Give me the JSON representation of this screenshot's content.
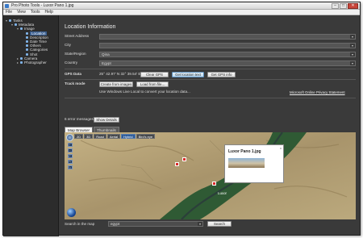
{
  "window": {
    "title": "Pro Photo Tools - Luxor Pano 1.jpg",
    "buttons": {
      "min": "–",
      "max": "□",
      "close": "✕"
    }
  },
  "menu": [
    "File",
    "View",
    "Tools",
    "Help"
  ],
  "sidebar": {
    "items": [
      {
        "label": "Tasks",
        "indent": 0,
        "twisty": "▾",
        "selected": false
      },
      {
        "label": "Metadata",
        "indent": 1,
        "twisty": "▾",
        "selected": false
      },
      {
        "label": "Image",
        "indent": 2,
        "twisty": "▾",
        "selected": false
      },
      {
        "label": "Location",
        "indent": 3,
        "twisty": "",
        "selected": true
      },
      {
        "label": "Description",
        "indent": 3,
        "twisty": "",
        "selected": false
      },
      {
        "label": "Date Time",
        "indent": 3,
        "twisty": "",
        "selected": false
      },
      {
        "label": "Others",
        "indent": 3,
        "twisty": "",
        "selected": false
      },
      {
        "label": "Categories",
        "indent": 3,
        "twisty": "",
        "selected": false
      },
      {
        "label": "Shot",
        "indent": 3,
        "twisty": "",
        "selected": false
      },
      {
        "label": "Camera",
        "indent": 2,
        "twisty": "▸",
        "selected": false
      },
      {
        "label": "Photographer",
        "indent": 2,
        "twisty": "▸",
        "selected": false
      }
    ]
  },
  "location": {
    "heading": "Location Information",
    "fields": [
      {
        "label": "Street Address",
        "value": ""
      },
      {
        "label": "City",
        "value": ""
      },
      {
        "label": "State/Region",
        "value": "Qina"
      },
      {
        "label": "Country",
        "value": "Egypt"
      }
    ],
    "dropdown_glyph": "▾"
  },
  "gps": {
    "label": "GPS Data",
    "value": "25° 42.97' N  32° 39.54' E",
    "clear_label": "Clear GPS",
    "get_location_label": "Get location text",
    "get_gps_info_label": "Get GPS info"
  },
  "track": {
    "label": "Track mode",
    "create_label": "Create from images",
    "load_label": "Load from file..."
  },
  "note": {
    "text": "Use Windows Live Local to convert your location data...",
    "privacy_link": "Microsoft Online Privacy Statement"
  },
  "errors": {
    "count_text": "6 error messages",
    "show_details_label": "Show Details"
  },
  "tabs": [
    "Map Browser",
    "Thumbnails"
  ],
  "map": {
    "modes": [
      {
        "label": "2D",
        "on": false
      },
      {
        "label": "3D",
        "on": false
      },
      {
        "label": "Road",
        "on": false
      },
      {
        "label": "Aerial",
        "on": false
      },
      {
        "label": "Hybrid",
        "on": true
      },
      {
        "label": "Bird's eye",
        "on": false
      }
    ],
    "nav_buttons": [
      "+",
      "−",
      "↶",
      "↷",
      "↻"
    ],
    "place_label": "Luxor",
    "popup_title": "Luxor Pano 1.jpg",
    "popup_close": "x",
    "colors": {
      "desert": "#b6a276",
      "river_green": "#2f5a34",
      "nile": "#2b3f3a"
    }
  },
  "search": {
    "label": "Search in the map",
    "value": "egypt",
    "button_label": "Search"
  }
}
